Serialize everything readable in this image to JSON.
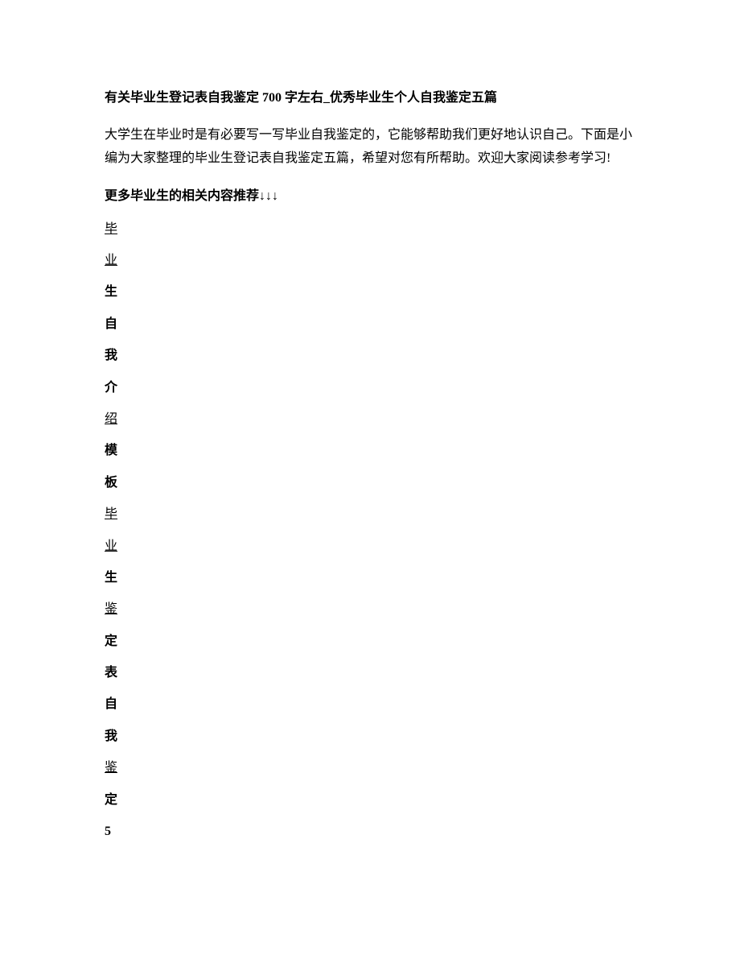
{
  "title": "有关毕业生登记表自我鉴定 700 字左右_优秀毕业生个人自我鉴定五篇",
  "intro": "大学生在毕业时是有必要写一写毕业自我鉴定的，它能够帮助我们更好地认识自己。下面是小编为大家整理的毕业生登记表自我鉴定五篇，希望对您有所帮助。欢迎大家阅读参考学习!",
  "recommend": "更多毕业生的相关内容推荐↓↓↓",
  "chars": [
    {
      "text": "毕",
      "underline": true,
      "bold": false
    },
    {
      "text": "业",
      "underline": true,
      "bold": false
    },
    {
      "text": "生",
      "underline": false,
      "bold": true
    },
    {
      "text": "自",
      "underline": false,
      "bold": true
    },
    {
      "text": "我",
      "underline": false,
      "bold": true
    },
    {
      "text": "介",
      "underline": false,
      "bold": true
    },
    {
      "text": "绍",
      "underline": true,
      "bold": false
    },
    {
      "text": "模",
      "underline": false,
      "bold": true
    },
    {
      "text": "板",
      "underline": false,
      "bold": true
    },
    {
      "text": "毕",
      "underline": true,
      "bold": false
    },
    {
      "text": "业",
      "underline": true,
      "bold": false
    },
    {
      "text": "生",
      "underline": false,
      "bold": true
    },
    {
      "text": "鉴",
      "underline": true,
      "bold": false
    },
    {
      "text": "定",
      "underline": false,
      "bold": true
    },
    {
      "text": "表",
      "underline": false,
      "bold": true
    },
    {
      "text": "自",
      "underline": false,
      "bold": true
    },
    {
      "text": "我",
      "underline": false,
      "bold": true
    },
    {
      "text": "鉴",
      "underline": true,
      "bold": false
    },
    {
      "text": "定",
      "underline": false,
      "bold": true
    },
    {
      "text": "5",
      "underline": false,
      "bold": true
    }
  ]
}
